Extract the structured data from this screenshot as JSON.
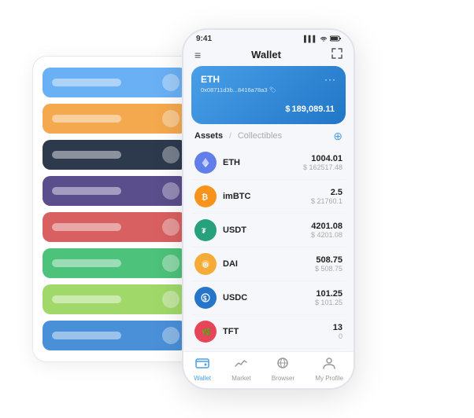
{
  "scene": {
    "background_color": "#ffffff"
  },
  "card_stack": {
    "items": [
      {
        "color_class": "si-blue",
        "id": "card-blue"
      },
      {
        "color_class": "si-orange",
        "id": "card-orange"
      },
      {
        "color_class": "si-dark",
        "id": "card-dark"
      },
      {
        "color_class": "si-purple",
        "id": "card-purple"
      },
      {
        "color_class": "si-red",
        "id": "card-red"
      },
      {
        "color_class": "si-green",
        "id": "card-green"
      },
      {
        "color_class": "si-lightgreen",
        "id": "card-lightgreen"
      },
      {
        "color_class": "si-royalblue",
        "id": "card-royalblue"
      }
    ]
  },
  "phone": {
    "status_bar": {
      "time": "9:41",
      "signal": "▌▌▌",
      "wifi": "WiFi",
      "battery": "🔋"
    },
    "header": {
      "menu_icon": "≡",
      "title": "Wallet",
      "expand_icon": "⤢"
    },
    "eth_card": {
      "label": "ETH",
      "dots": "···",
      "address": "0x08711d3b...8416a78a3 🏷",
      "currency_symbol": "$",
      "amount": "189,089.11"
    },
    "assets_section": {
      "tab_active": "Assets",
      "tab_separator": "/",
      "tab_inactive": "Collectibles",
      "add_icon": "⊕"
    },
    "assets": [
      {
        "symbol": "ETH",
        "icon_label": "◆",
        "icon_class": "icon-eth",
        "amount": "1004.01",
        "usd": "$ 162517.48"
      },
      {
        "symbol": "imBTC",
        "icon_label": "₿",
        "icon_class": "icon-imbtc",
        "amount": "2.5",
        "usd": "$ 21760.1"
      },
      {
        "symbol": "USDT",
        "icon_label": "₮",
        "icon_class": "icon-usdt",
        "amount": "4201.08",
        "usd": "$ 4201.08"
      },
      {
        "symbol": "DAI",
        "icon_label": "◎",
        "icon_class": "icon-dai",
        "amount": "508.75",
        "usd": "$ 508.75"
      },
      {
        "symbol": "USDC",
        "icon_label": "©",
        "icon_class": "icon-usdc",
        "amount": "101.25",
        "usd": "$ 101.25"
      },
      {
        "symbol": "TFT",
        "icon_label": "✦",
        "icon_class": "icon-tft",
        "amount": "13",
        "usd": "0"
      }
    ],
    "nav": [
      {
        "icon": "👛",
        "label": "Wallet",
        "active": true
      },
      {
        "icon": "📈",
        "label": "Market",
        "active": false
      },
      {
        "icon": "🌐",
        "label": "Browser",
        "active": false
      },
      {
        "icon": "👤",
        "label": "My Profile",
        "active": false
      }
    ]
  }
}
